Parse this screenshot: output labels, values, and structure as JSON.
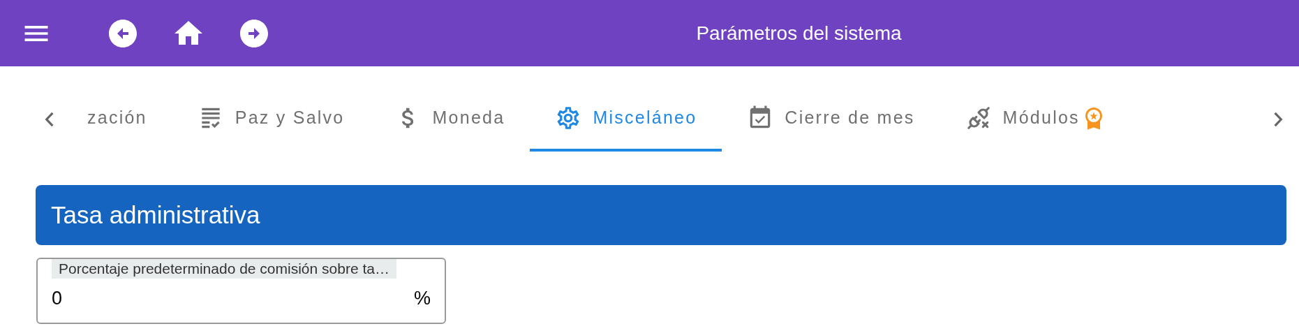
{
  "header": {
    "title": "Parámetros del sistema"
  },
  "tabs": [
    {
      "label": "zación",
      "kind": "none",
      "selected": false,
      "premium": false
    },
    {
      "label": "Paz y Salvo",
      "kind": "checklist",
      "selected": false,
      "premium": false
    },
    {
      "label": "Moneda",
      "kind": "dollar",
      "selected": false,
      "premium": false
    },
    {
      "label": "Misceláneo",
      "kind": "gear",
      "selected": true,
      "premium": false
    },
    {
      "label": "Cierre de mes",
      "kind": "calendar",
      "selected": false,
      "premium": false
    },
    {
      "label": "Módulos",
      "kind": "plug",
      "selected": false,
      "premium": true
    }
  ],
  "section": {
    "title": "Tasa administrativa"
  },
  "field": {
    "label": "Porcentaje predeterminado de comisión sobre ta…",
    "value": "0",
    "suffix": "%"
  }
}
